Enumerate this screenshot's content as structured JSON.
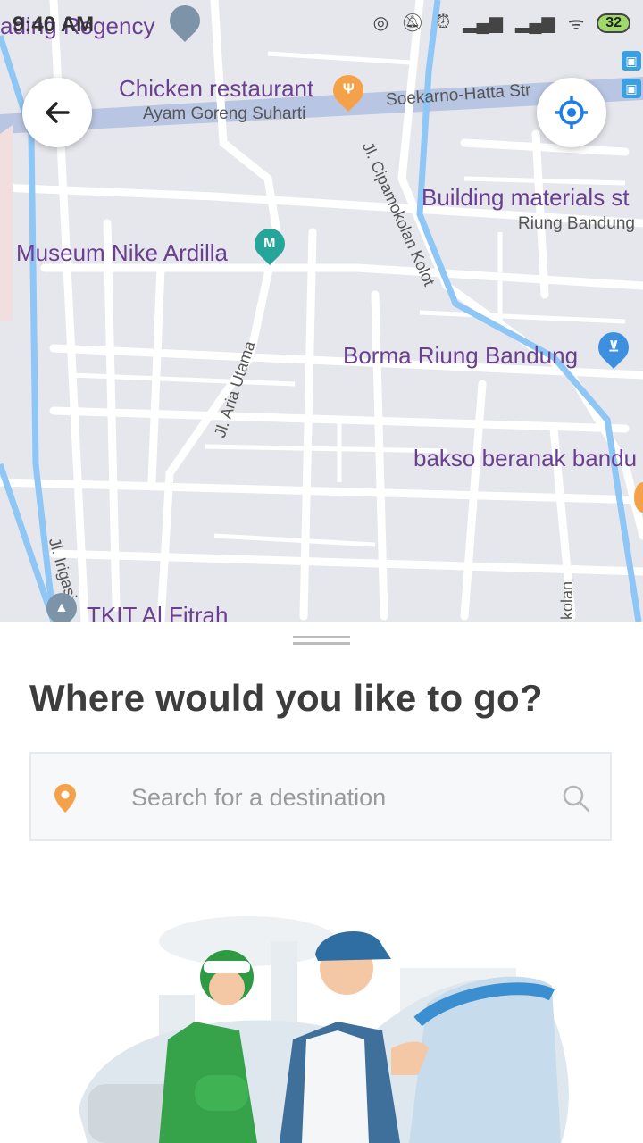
{
  "status_bar": {
    "time": "9:40 AM",
    "battery": "32"
  },
  "map": {
    "places": {
      "regency": "ading Regency",
      "chicken": "Chicken restaurant",
      "chicken_sub": "Ayam Goreng Suharti",
      "soekarno": "Soekarno-Hatta Str",
      "building": "Building materials st",
      "building_sub": "Riung Bandung",
      "museum": "Museum Nike Ardilla",
      "borma": "Borma Riung Bandung",
      "bakso": "bakso beranak bandu",
      "tkit": "TKIT Al Fitrah"
    },
    "roads": {
      "cipamokolan": "Jl. Cipamokolan Kolot",
      "aria": "Jl. Aria Utama",
      "irigasi": "Jl. Irigasi",
      "kolan": "kolan"
    },
    "museum_pin_letter": "M"
  },
  "sheet": {
    "title": "Where would you like to go?",
    "search": {
      "placeholder": "Search for a destination",
      "value": ""
    }
  },
  "colors": {
    "accent": "#f5a14a",
    "river": "#8ec6f5",
    "map_bg": "#e6e7ec",
    "place_text": "#6a3f8f"
  },
  "icons": [
    "back-arrow-icon",
    "my-location-icon",
    "search-icon",
    "location-pin-icon"
  ]
}
